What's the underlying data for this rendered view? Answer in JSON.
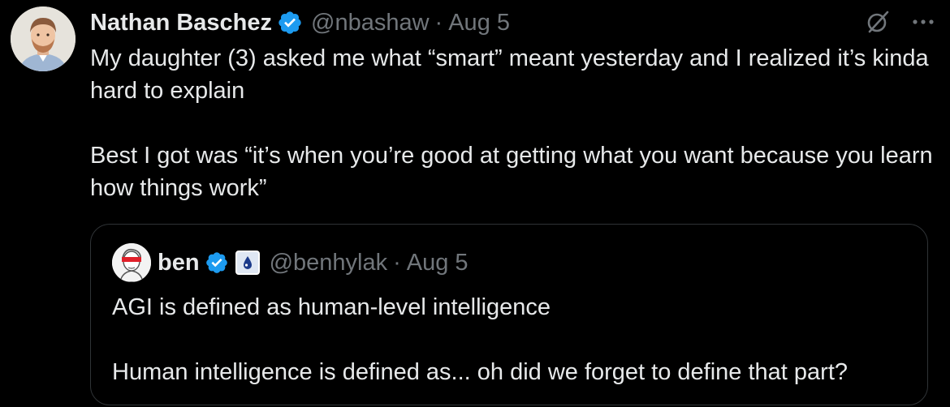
{
  "tweet": {
    "author": {
      "display_name": "Nathan Baschez",
      "handle": "@nbashaw",
      "verified": true,
      "avatar_icon": "avatar-photo"
    },
    "separator": "·",
    "date": "Aug 5",
    "actions": {
      "grok_icon": "grok-slash-icon",
      "more_icon": "more-dots-icon"
    },
    "text_lines": [
      "My daughter (3) asked me what “smart” meant yesterday and I realized it’s kinda hard to explain",
      "Best I got was “it’s when you’re good at getting what you want because you learn how things work”"
    ]
  },
  "quoted_tweet": {
    "author": {
      "display_name": "ben",
      "handle": "@benhylak",
      "verified": true,
      "affiliation_badge": "company-badge-icon"
    },
    "separator": "·",
    "date": "Aug 5",
    "text_lines": [
      "AGI is defined as human-level intelligence",
      "Human intelligence is defined as... oh did we forget to define that part?"
    ]
  },
  "colors": {
    "background": "#000000",
    "text_primary": "#e7e9ea",
    "text_secondary": "#71767b",
    "verified_blue": "#1d9bf0",
    "border": "#2f3336"
  }
}
